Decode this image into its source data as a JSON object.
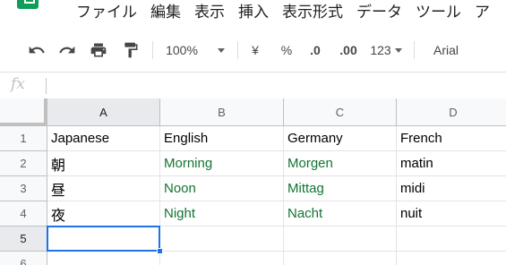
{
  "menubar": {
    "items": [
      "ファイル",
      "編集",
      "表示",
      "挿入",
      "表示形式",
      "データ",
      "ツール",
      "ア"
    ]
  },
  "toolbar": {
    "zoom": "100%",
    "currency": "¥",
    "percent": "%",
    "decrease_decimal": ".0",
    "increase_decimal": ".00",
    "number_format": "123",
    "font": "Arial"
  },
  "formula_bar": {
    "fx_label": "fx",
    "value": ""
  },
  "sheet": {
    "columns": [
      "A",
      "B",
      "C",
      "D"
    ],
    "rows": [
      "1",
      "2",
      "3",
      "4",
      "5",
      "6"
    ],
    "cells": [
      [
        "Japanese",
        "English",
        "Germany",
        "French"
      ],
      [
        "朝",
        "Morning",
        "Morgen",
        "matin"
      ],
      [
        "昼",
        "Noon",
        "Mittag",
        "midi"
      ],
      [
        "夜",
        "Night",
        "Nacht",
        "nuit"
      ],
      [
        "",
        "",
        "",
        ""
      ],
      [
        "",
        "",
        "",
        ""
      ]
    ],
    "selected_cell": "A5",
    "colors": {
      "green_text": "#137333",
      "selection": "#1a73e8"
    }
  }
}
